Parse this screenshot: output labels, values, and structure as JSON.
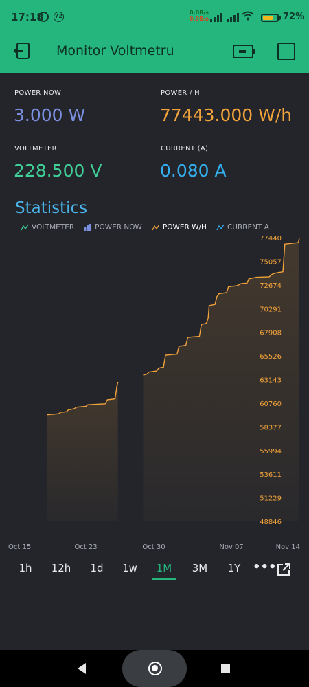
{
  "status_bar": {
    "time": "17:18",
    "notification_count": "72",
    "net_up": "0.0B/s",
    "net_down": "0.0B/s",
    "battery_percent": "72%",
    "battery_level": 0.72,
    "icons": [
      "alarm-icon",
      "notification-badge-icon",
      "signal-icon",
      "signal-icon",
      "wifi-icon",
      "battery-icon"
    ]
  },
  "app_bar": {
    "title": "Monitor Voltmetru",
    "icons": [
      "exit-icon",
      "device-icon",
      "square-icon"
    ]
  },
  "metrics": [
    {
      "label": "POWER NOW",
      "value": "3.000 W",
      "color": "#7b8fe0"
    },
    {
      "label": "POWER / H",
      "value": "77443.000 W/h",
      "color": "#f2a33a"
    },
    {
      "label": "VOLTMETER",
      "value": "228.500 V",
      "color": "#3fcf97"
    },
    {
      "label": "CURRENT (A)",
      "value": "0.080 A",
      "color": "#34b0f0"
    }
  ],
  "statistics": {
    "title": "Statistics",
    "legend": [
      {
        "label": "VOLTMETER",
        "color": "#3fcf97",
        "active": false
      },
      {
        "label": "POWER NOW",
        "color": "#7b8fe0",
        "active": false
      },
      {
        "label": "POWER  W/H",
        "color": "#f2a33a",
        "active": true
      },
      {
        "label": "CURRENT  A",
        "color": "#34b0f0",
        "active": false
      }
    ]
  },
  "chart_data": {
    "type": "area",
    "series_name": "POWER  W/H",
    "color": "#f2a33a",
    "x_tick_labels": [
      "Oct 15",
      "Oct 23",
      "Oct 30",
      "Nov 07",
      "Nov 14"
    ],
    "x_ticks": [
      0,
      8,
      15,
      23,
      30
    ],
    "x_domain": [
      0,
      30
    ],
    "y_tick_labels": [
      "77440",
      "75057",
      "72674",
      "70291",
      "67908",
      "65526",
      "63143",
      "60760",
      "58377",
      "55994",
      "53611",
      "51229",
      "48846"
    ],
    "ylim": [
      48846,
      77440
    ],
    "segments": [
      [
        [
          4.0,
          59600
        ],
        [
          5.2,
          59700
        ],
        [
          5.4,
          59850
        ],
        [
          6.0,
          59900
        ],
        [
          6.2,
          60100
        ],
        [
          6.8,
          60200
        ],
        [
          7.0,
          60350
        ],
        [
          8.0,
          60450
        ],
        [
          8.2,
          60600
        ],
        [
          10.0,
          60700
        ],
        [
          10.2,
          61100
        ],
        [
          11.0,
          61200
        ],
        [
          11.2,
          62500
        ],
        [
          11.3,
          62900
        ]
      ],
      [
        [
          13.9,
          63600
        ],
        [
          14.3,
          63700
        ],
        [
          14.5,
          63900
        ],
        [
          15.3,
          64000
        ],
        [
          15.5,
          64300
        ],
        [
          16.0,
          64400
        ],
        [
          16.2,
          65600
        ],
        [
          17.4,
          65700
        ],
        [
          17.6,
          66500
        ],
        [
          18.3,
          66600
        ],
        [
          18.5,
          67400
        ],
        [
          19.7,
          67500
        ],
        [
          19.9,
          68700
        ],
        [
          20.4,
          68800
        ],
        [
          20.6,
          69300
        ],
        [
          20.7,
          70600
        ],
        [
          21.3,
          70700
        ],
        [
          21.5,
          71500
        ],
        [
          21.7,
          71800
        ],
        [
          22.5,
          71900
        ],
        [
          22.7,
          72500
        ],
        [
          23.6,
          72600
        ],
        [
          24.0,
          72800
        ],
        [
          24.6,
          72850
        ],
        [
          24.8,
          73300
        ],
        [
          25.6,
          73450
        ],
        [
          26.9,
          73500
        ],
        [
          27.1,
          73700
        ],
        [
          27.3,
          73800
        ],
        [
          27.7,
          73900
        ],
        [
          28.3,
          74000
        ],
        [
          28.5,
          76800
        ],
        [
          29.9,
          76950
        ],
        [
          30.0,
          77440
        ]
      ]
    ],
    "grid": false
  },
  "time_ranges": {
    "options": [
      "1h",
      "12h",
      "1d",
      "1w",
      "1M",
      "3M",
      "1Y"
    ],
    "selected": "1M",
    "more_icon": "more-icon",
    "share_icon": "share-icon"
  },
  "nav_bar": {
    "icons": [
      "back-icon",
      "home-icon",
      "recents-icon"
    ]
  }
}
